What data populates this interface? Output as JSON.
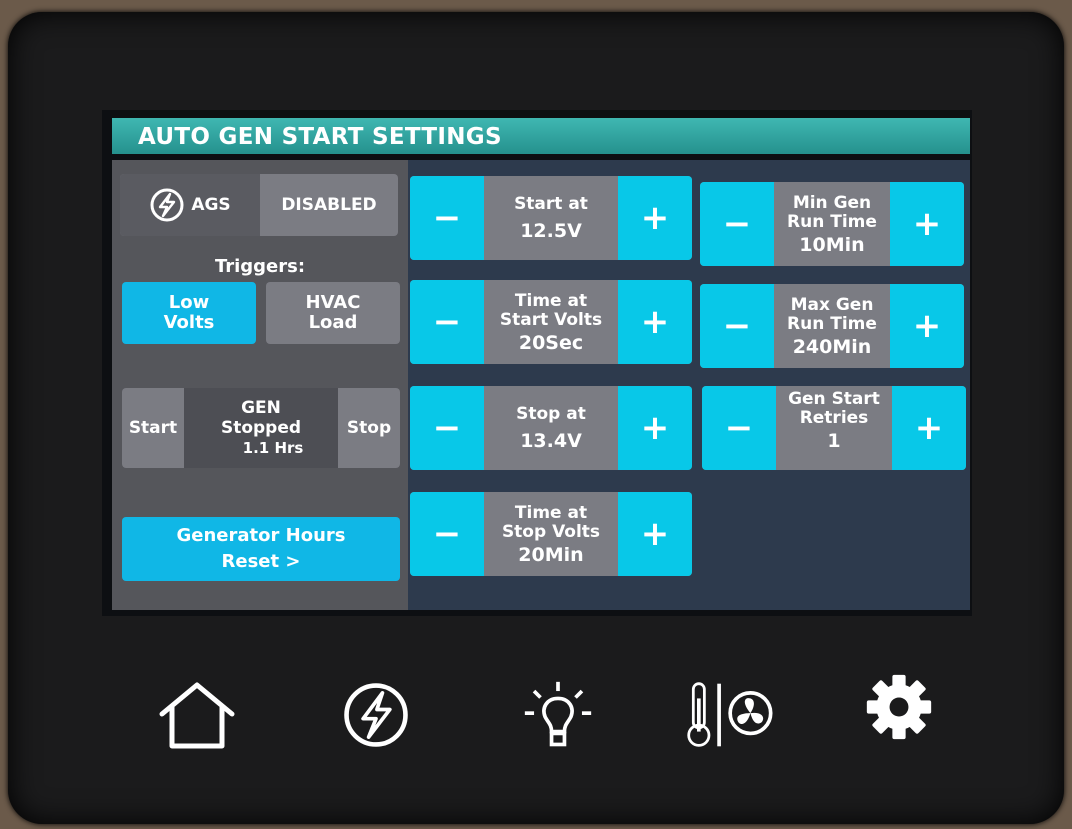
{
  "title": "AUTO GEN START SETTINGS",
  "ags": {
    "label": "AGS",
    "status": "DISABLED"
  },
  "triggers": {
    "heading": "Triggers:",
    "low_volts": [
      "Low",
      "Volts"
    ],
    "hvac_load": [
      "HVAC",
      "Load"
    ]
  },
  "gen": {
    "start_label": "Start",
    "stop_label": "Stop",
    "line1": "GEN",
    "line2": "Stopped",
    "line3": "1.1 Hrs"
  },
  "generator_hours": {
    "line1": "Generator Hours",
    "line2": "Reset >"
  },
  "steppers": {
    "start_at": {
      "label1": "Start at",
      "label2": "",
      "value": "12.5V"
    },
    "time_start_volts": {
      "label1": "Time at",
      "label2": "Start Volts",
      "value": "20Sec"
    },
    "stop_at": {
      "label1": "Stop at",
      "label2": "",
      "value": "13.4V"
    },
    "time_stop_volts": {
      "label1": "Time at",
      "label2": "Stop Volts",
      "value": "20Min"
    },
    "min_gen_run": {
      "label1": "Min Gen",
      "label2": "Run Time",
      "value": "10Min"
    },
    "max_gen_run": {
      "label1": "Max Gen",
      "label2": "Run Time",
      "value": "240Min"
    },
    "gen_start_retries": {
      "label1": "Gen Start",
      "label2": "Retries",
      "value": "1"
    }
  },
  "stepper_symbols": {
    "minus": "−",
    "plus": "+"
  },
  "nav": [
    "home-icon",
    "generator-icon",
    "light-icon",
    "climate-fan-icon",
    "settings-gear-icon"
  ],
  "colors": {
    "accent_cyan": "#08c8e8",
    "title_teal": "#2aa39e",
    "button_grey": "#7b7c83"
  }
}
